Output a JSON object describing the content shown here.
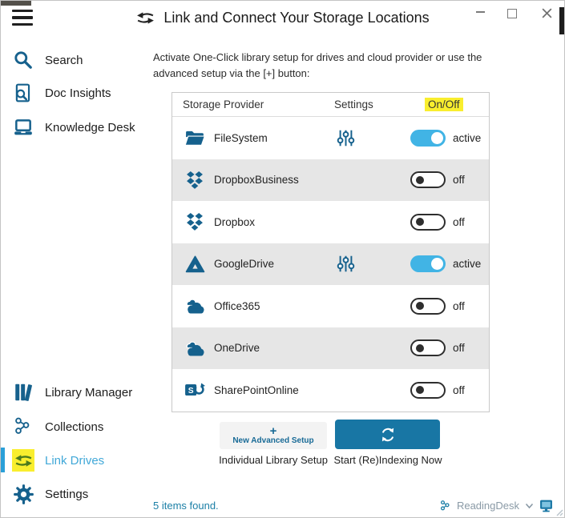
{
  "window": {
    "title": "Link and Connect Your Storage Locations"
  },
  "sidebar": {
    "top_items": [
      {
        "label": "Search"
      },
      {
        "label": "Doc Insights"
      },
      {
        "label": "Knowledge Desk"
      }
    ],
    "bottom_items": [
      {
        "label": "Library Manager"
      },
      {
        "label": "Collections"
      },
      {
        "label": "Link Drives",
        "selected": true
      },
      {
        "label": "Settings"
      }
    ]
  },
  "main": {
    "instruction": "Activate One-Click library setup for drives and cloud provider or use the advanced setup via the [+] button:",
    "table": {
      "headers": {
        "provider": "Storage Provider",
        "settings": "Settings",
        "onoff": "On/Off"
      },
      "rows": [
        {
          "name": "FileSystem",
          "icon": "filesystem",
          "has_settings": true,
          "on": true,
          "state": "active"
        },
        {
          "name": "DropboxBusiness",
          "icon": "dropbox",
          "has_settings": false,
          "on": false,
          "state": "off"
        },
        {
          "name": "Dropbox",
          "icon": "dropbox",
          "has_settings": false,
          "on": false,
          "state": "off"
        },
        {
          "name": "GoogleDrive",
          "icon": "googledrive",
          "has_settings": true,
          "on": true,
          "state": "active"
        },
        {
          "name": "Office365",
          "icon": "cloud",
          "has_settings": false,
          "on": false,
          "state": "off"
        },
        {
          "name": "OneDrive",
          "icon": "cloud",
          "has_settings": false,
          "on": false,
          "state": "off"
        },
        {
          "name": "SharePointOnline",
          "icon": "sharepoint",
          "has_settings": false,
          "on": false,
          "state": "off"
        }
      ]
    },
    "actions": {
      "advanced": {
        "plus": "+",
        "label": "New Advanced Setup",
        "caption": "Individual Library Setup"
      },
      "reindex": {
        "caption": "Start (Re)Indexing Now"
      }
    }
  },
  "statusbar": {
    "items_found": "5 items found.",
    "app_name": "ReadingDesk"
  },
  "colors": {
    "accent_blue": "#1876a4",
    "icon_blue": "#15618d",
    "toggle_active": "#41b4e5",
    "highlight_yellow": "#f9ee2e",
    "selected_item_text": "#41a8d8",
    "row_alt_gray": "#e6e6e6",
    "status_teal": "#1b7fa6"
  }
}
